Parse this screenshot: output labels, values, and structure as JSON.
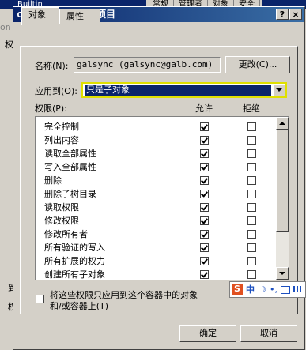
{
  "background": {
    "title": "Builtin",
    "tabs": [
      "常规",
      "管理者",
      "对象",
      "安全"
    ],
    "fragments": [
      "on",
      "权",
      "到",
      "权"
    ]
  },
  "dialog": {
    "title": "contacts 的权限项目",
    "help_button": "?",
    "close_button": "×",
    "tabs": [
      "对象",
      "属性"
    ],
    "name_label": "名称(N):",
    "name_value": "galsync (galsync@galb.com)",
    "change_button": "更改(C)...",
    "apply_label": "应用到(O):",
    "apply_value": "只是子对象",
    "perm_label": "权限(P):",
    "col_allow": "允许",
    "col_deny": "拒绝",
    "permissions": [
      {
        "name": "完全控制",
        "allow": true,
        "deny": false
      },
      {
        "name": "列出内容",
        "allow": true,
        "deny": false
      },
      {
        "name": "读取全部属性",
        "allow": true,
        "deny": false
      },
      {
        "name": "写入全部属性",
        "allow": true,
        "deny": false
      },
      {
        "name": "删除",
        "allow": true,
        "deny": false
      },
      {
        "name": "删除子树目录",
        "allow": true,
        "deny": false
      },
      {
        "name": "读取权限",
        "allow": true,
        "deny": false
      },
      {
        "name": "修改权限",
        "allow": true,
        "deny": false
      },
      {
        "name": "修改所有者",
        "allow": true,
        "deny": false
      },
      {
        "name": "所有验证的写入",
        "allow": true,
        "deny": false
      },
      {
        "name": "所有扩展的权力",
        "allow": true,
        "deny": false
      },
      {
        "name": "创建所有子对象",
        "allow": true,
        "deny": false
      }
    ],
    "inherit_checkbox_label_1": "将这些权限只应用到这个容器中的对象",
    "inherit_checkbox_label_2": "和/或容器上(T)",
    "inherit_checked": false,
    "ok_button": "确定",
    "cancel_button": "取消"
  },
  "ime": {
    "logo": "S",
    "mode": "中",
    "punct": "•,",
    "moon": "☽"
  },
  "colors": {
    "title_start": "#0a246a",
    "title_end": "#3a6ea5",
    "face": "#d4d0c8",
    "selection": "#0a246a",
    "combo_border": "#e0e000"
  }
}
